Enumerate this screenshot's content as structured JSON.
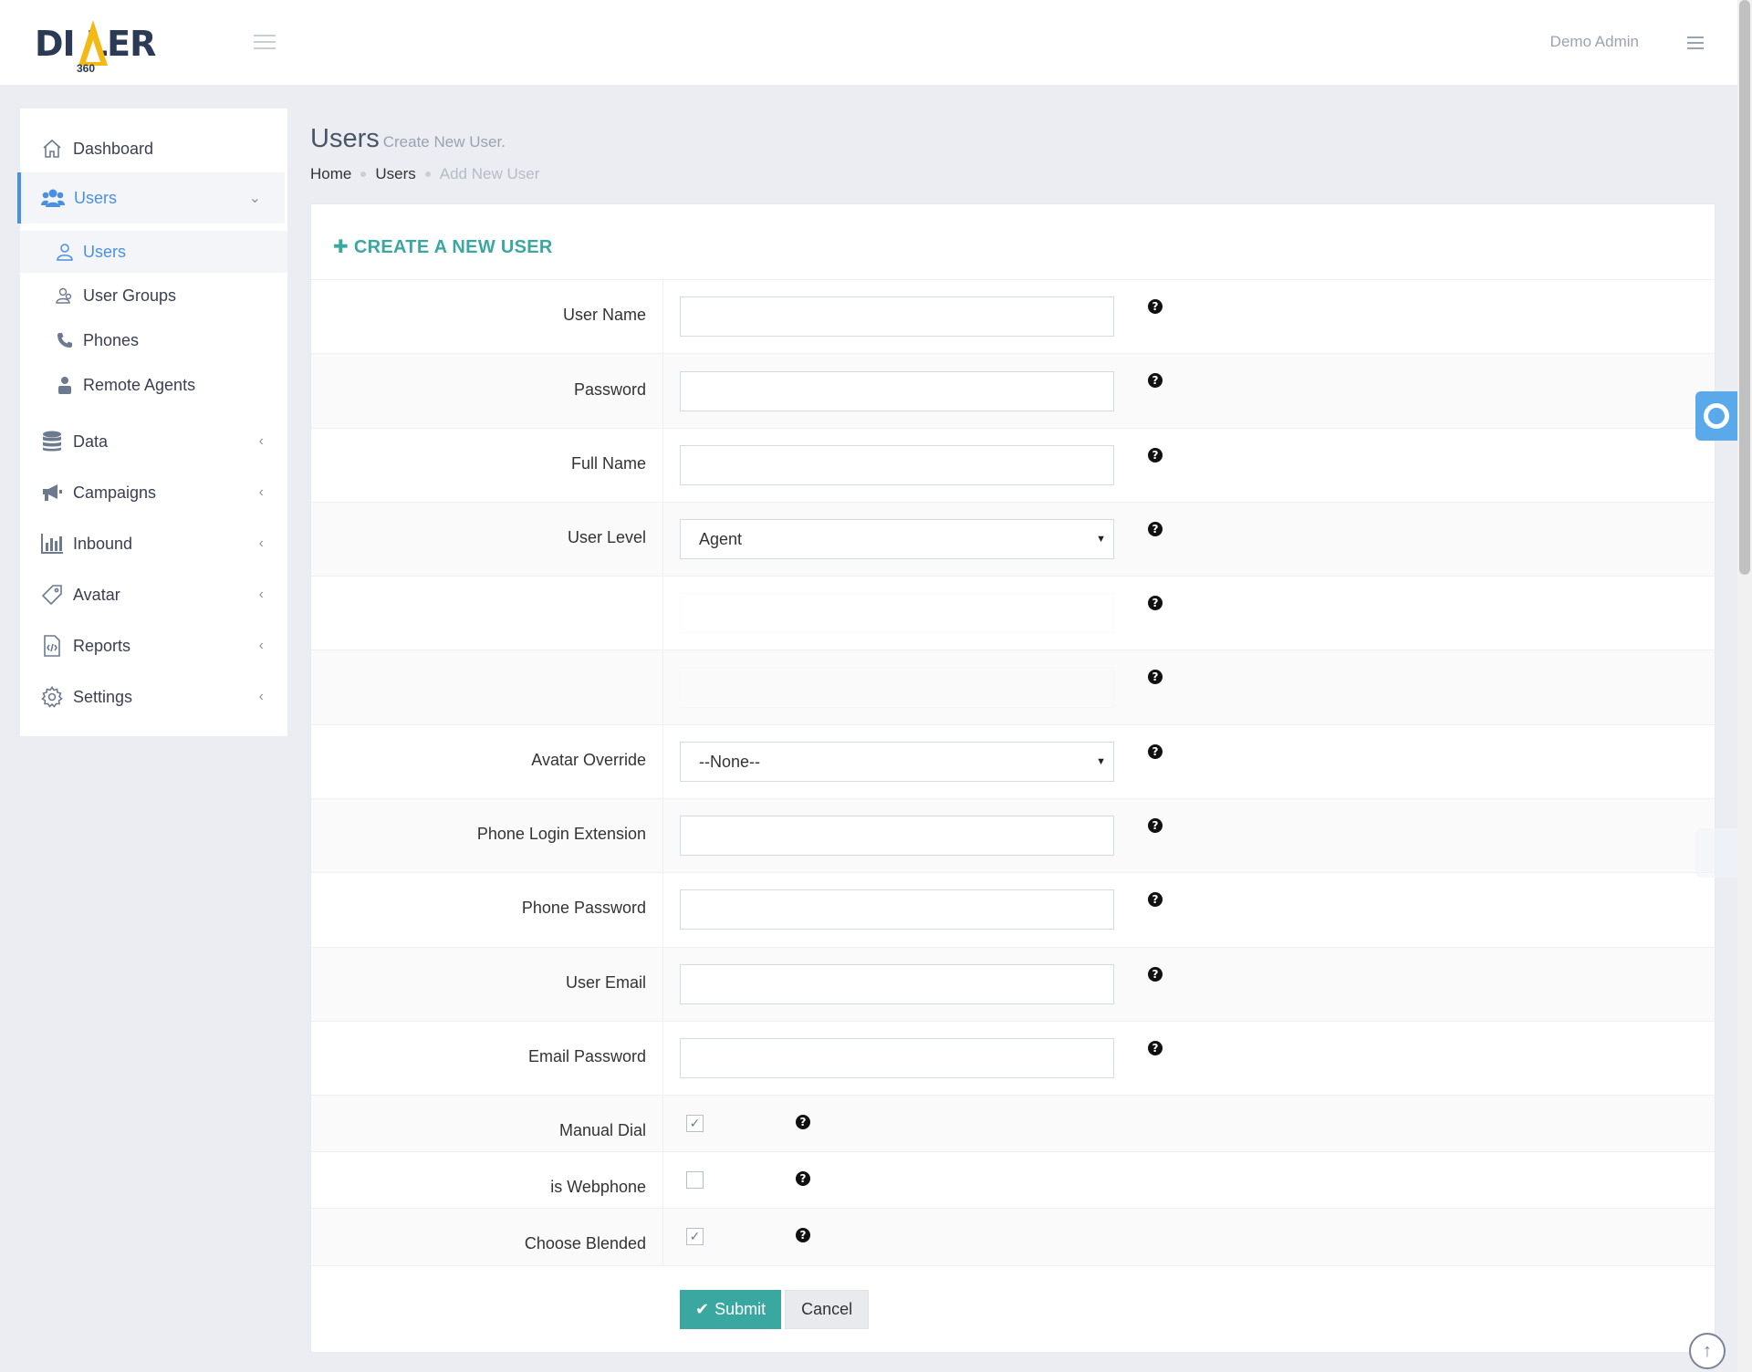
{
  "header": {
    "logo_text": "DI LER",
    "logo_sub": "360",
    "user_name": "Demo Admin"
  },
  "sidebar": {
    "items": [
      {
        "label": "Dashboard",
        "icon": "home-icon"
      },
      {
        "label": "Users",
        "icon": "users-icon"
      },
      {
        "label": "Data",
        "icon": "database-icon"
      },
      {
        "label": "Campaigns",
        "icon": "megaphone-icon"
      },
      {
        "label": "Inbound",
        "icon": "bar-chart-icon"
      },
      {
        "label": "Avatar",
        "icon": "tag-icon"
      },
      {
        "label": "Reports",
        "icon": "report-icon"
      },
      {
        "label": "Settings",
        "icon": "gear-icon"
      }
    ],
    "subitems": [
      {
        "label": "Users",
        "icon": "user-icon"
      },
      {
        "label": "User Groups",
        "icon": "user-group-icon"
      },
      {
        "label": "Phones",
        "icon": "phone-icon"
      },
      {
        "label": "Remote Agents",
        "icon": "agent-icon"
      }
    ]
  },
  "page": {
    "title": "Users",
    "subtitle": "Create New User.",
    "breadcrumb": [
      "Home",
      "Users",
      "Add New User"
    ]
  },
  "form": {
    "heading": "CREATE A NEW USER",
    "fields": {
      "user_name": "User Name",
      "password": "Password",
      "full_name": "Full Name",
      "user_level": "User Level",
      "user_level_value": "Agent",
      "avatar_override": "Avatar Override",
      "avatar_override_value": "--None--",
      "phone_login": "Phone Login Extension",
      "phone_password": "Phone Password",
      "user_email": "User Email",
      "email_password": "Email Password",
      "manual_dial": "Manual Dial",
      "is_webphone": "is Webphone",
      "choose_blended": "Choose Blended"
    },
    "checkboxes": {
      "manual_dial": true,
      "is_webphone": false,
      "choose_blended": true
    },
    "submit_label": "Submit",
    "cancel_label": "Cancel"
  },
  "colors": {
    "accent": "#3aa8a0",
    "nav_active": "#4a90e2"
  }
}
